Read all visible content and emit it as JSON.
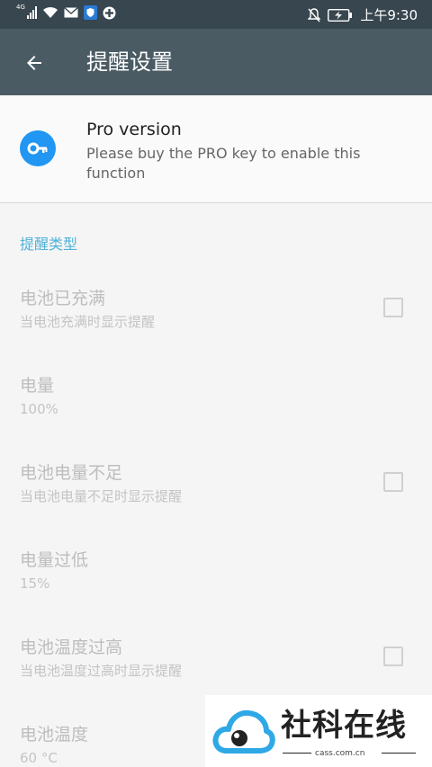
{
  "status_bar": {
    "network": "4G",
    "time": "上午9:30"
  },
  "app_bar": {
    "title": "提醒设置"
  },
  "pro": {
    "title": "Pro version",
    "description": "Please buy the PRO key to enable this function",
    "icon": "key-icon",
    "icon_color": "#2196f3"
  },
  "section": {
    "header": "提醒类型"
  },
  "prefs": [
    {
      "title": "电池已充满",
      "summary": "当电池充满时显示提醒",
      "checkbox": true,
      "checked": false
    },
    {
      "title": "电量",
      "summary": "100%",
      "checkbox": false
    },
    {
      "title": "电池电量不足",
      "summary": "当电池电量不足时显示提醒",
      "checkbox": true,
      "checked": false
    },
    {
      "title": "电量过低",
      "summary": "15%",
      "checkbox": false
    },
    {
      "title": "电池温度过高",
      "summary": "当电池温度过高时显示提醒",
      "checkbox": true,
      "checked": false
    },
    {
      "title": "电池温度",
      "summary": "60 °C",
      "checkbox": false
    }
  ],
  "watermark": {
    "name": "社科在线",
    "url": "cass.com.cn"
  },
  "colors": {
    "status_bar": "#37464f",
    "app_bar": "#4a5b64",
    "accent": "#4fb3d9"
  }
}
